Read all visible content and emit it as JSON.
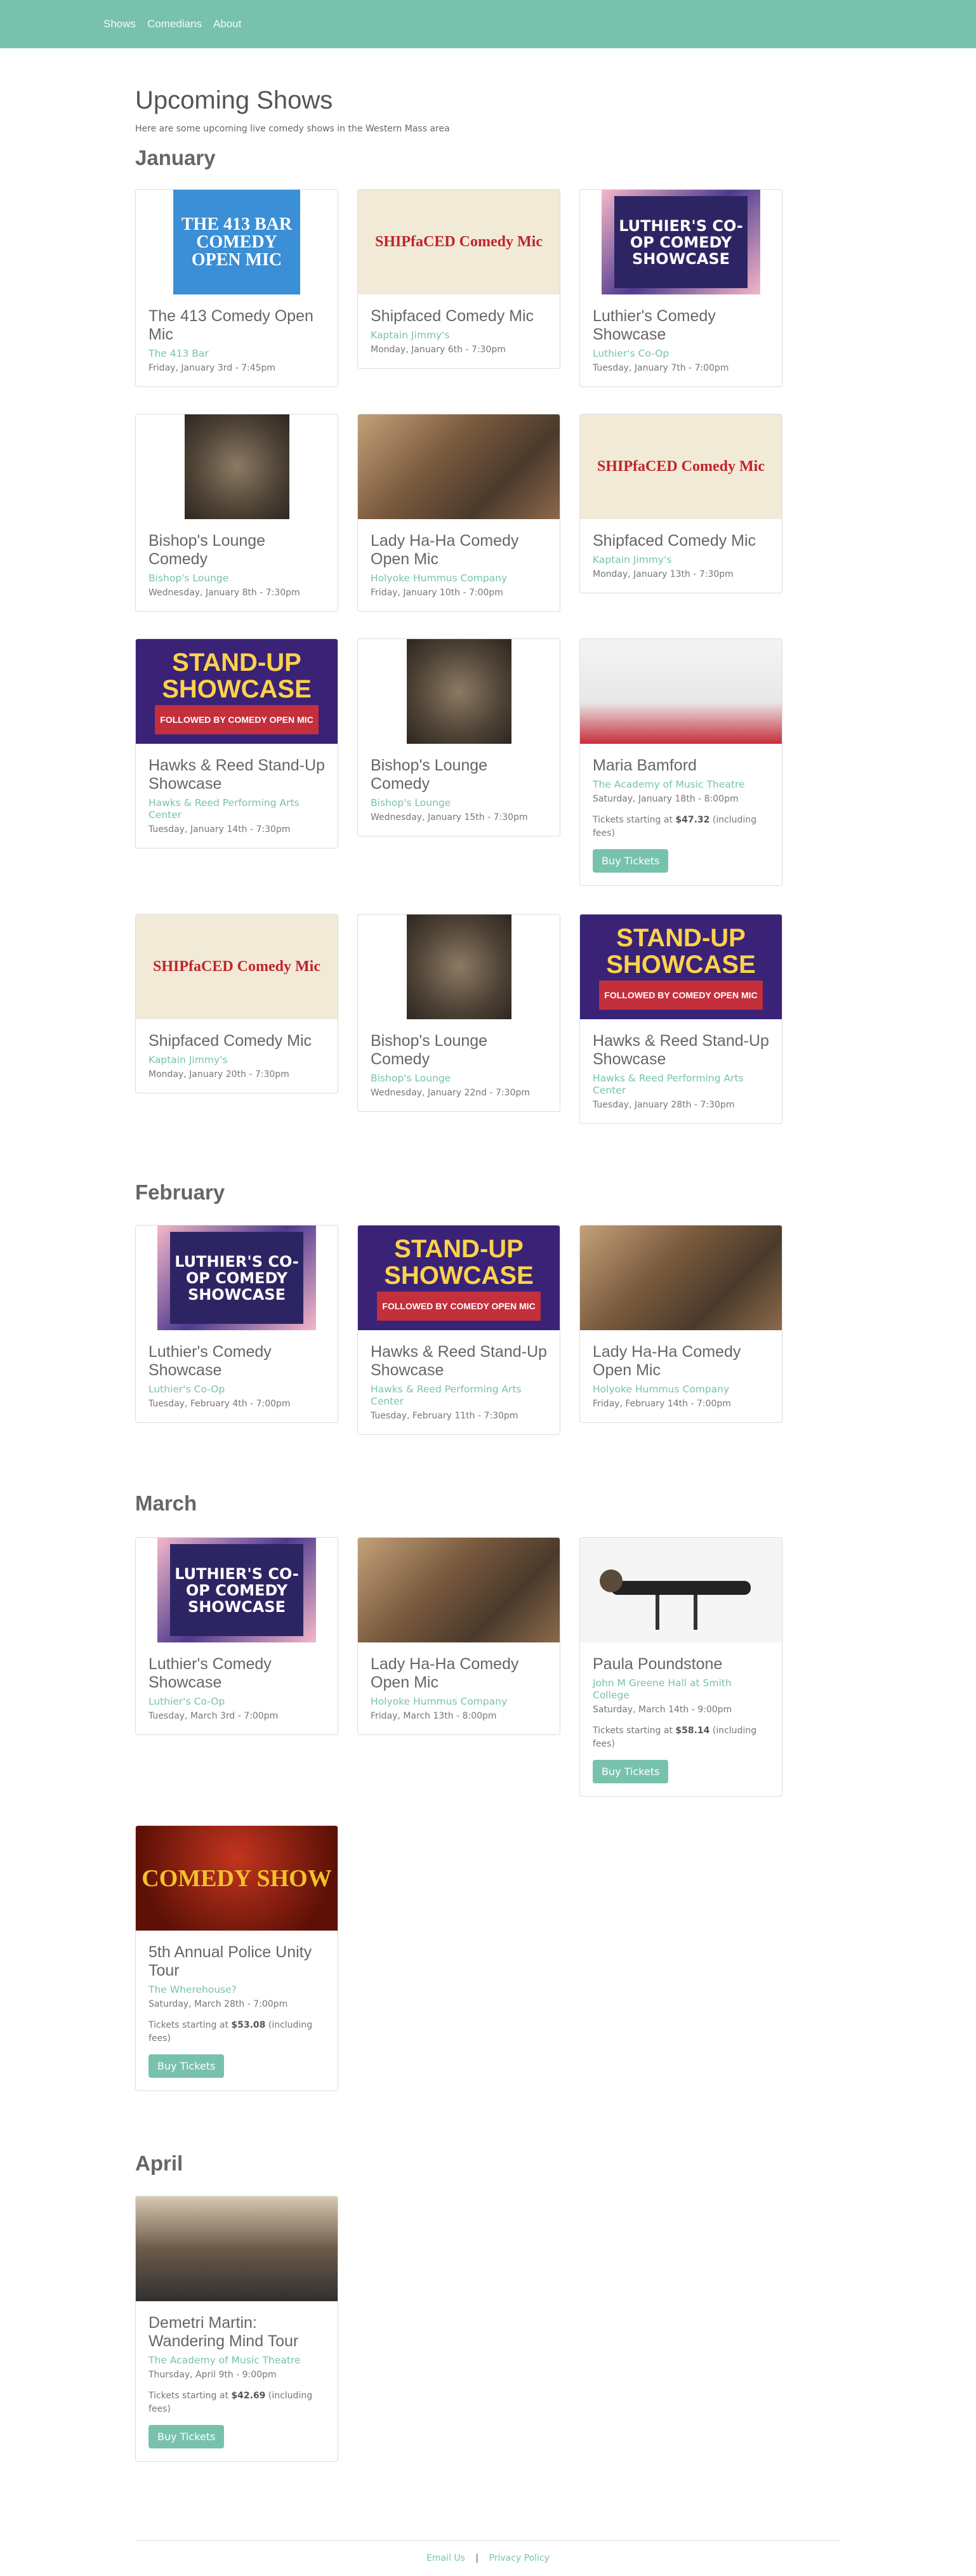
{
  "nav": {
    "items": [
      "Shows",
      "Comedians",
      "About"
    ]
  },
  "page": {
    "title": "Upcoming Shows",
    "subtitle": "Here are some upcoming live comedy shows in the Western Mass area"
  },
  "months": [
    "January",
    "February",
    "March",
    "April"
  ],
  "shows": [
    {
      "title": "The 413 Comedy Open Mic",
      "venue": "The 413 Bar",
      "date": "Friday, January 3rd - 7:45pm",
      "poster_text": "THE 413 BAR COMEDY OPEN MIC"
    },
    {
      "title": "Shipfaced Comedy Mic",
      "venue": "Kaptain Jimmy's",
      "date": "Monday, January 6th - 7:30pm",
      "poster_text": "SHIPfaCED Comedy Mic"
    },
    {
      "title": "Luthier's Comedy Showcase",
      "venue": "Luthier's Co-Op",
      "date": "Tuesday, January 7th - 7:00pm",
      "poster_text": "LUTHIER'S CO-OP COMEDY SHOWCASE"
    },
    {
      "title": "Bishop's Lounge Comedy",
      "venue": "Bishop's Lounge",
      "date": "Wednesday, January 8th - 7:30pm",
      "poster_text": ""
    },
    {
      "title": "Lady Ha-Ha Comedy Open Mic",
      "venue": "Holyoke Hummus Company",
      "date": "Friday, January 10th - 7:00pm"
    },
    {
      "title": "Shipfaced Comedy Mic",
      "venue": "Kaptain Jimmy's",
      "date": "Monday, January 13th - 7:30pm",
      "poster_text": "SHIPfaCED Comedy Mic"
    },
    {
      "title": "Hawks & Reed Stand-Up Showcase",
      "venue": "Hawks & Reed Performing Arts Center",
      "date": "Tuesday, January 14th - 7:30pm",
      "poster_text": "STAND-UP SHOWCASE",
      "poster_sub": "FOLLOWED BY COMEDY OPEN MIC"
    },
    {
      "title": "Bishop's Lounge Comedy",
      "venue": "Bishop's Lounge",
      "date": "Wednesday, January 15th - 7:30pm"
    },
    {
      "title": "Maria Bamford",
      "venue": "The Academy of Music Theatre",
      "date": "Saturday, January 18th - 8:00pm",
      "price_prefix": "Tickets starting at ",
      "price": "$47.32",
      "price_suffix": " (including fees)",
      "button": "Buy Tickets"
    },
    {
      "title": "Shipfaced Comedy Mic",
      "venue": "Kaptain Jimmy's",
      "date": "Monday, January 20th - 7:30pm",
      "poster_text": "SHIPfaCED Comedy Mic"
    },
    {
      "title": "Bishop's Lounge Comedy",
      "venue": "Bishop's Lounge",
      "date": "Wednesday, January 22nd - 7:30pm"
    },
    {
      "title": "Hawks & Reed Stand-Up Showcase",
      "venue": "Hawks & Reed Performing Arts Center",
      "date": "Tuesday, January 28th - 7:30pm",
      "poster_text": "STAND-UP SHOWCASE",
      "poster_sub": "FOLLOWED BY COMEDY OPEN MIC"
    },
    {
      "title": "Luthier's Comedy Showcase",
      "venue": "Luthier's Co-Op",
      "date": "Tuesday, February 4th - 7:00pm",
      "poster_text": "LUTHIER'S CO-OP COMEDY SHOWCASE"
    },
    {
      "title": "Hawks & Reed Stand-Up Showcase",
      "venue": "Hawks & Reed Performing Arts Center",
      "date": "Tuesday, February 11th - 7:30pm",
      "poster_text": "STAND-UP SHOWCASE",
      "poster_sub": "FOLLOWED BY COMEDY OPEN MIC"
    },
    {
      "title": "Lady Ha-Ha Comedy Open Mic",
      "venue": "Holyoke Hummus Company",
      "date": "Friday, February 14th - 7:00pm"
    },
    {
      "title": "Luthier's Comedy Showcase",
      "venue": "Luthier's Co-Op",
      "date": "Tuesday, March 3rd - 7:00pm",
      "poster_text": "LUTHIER'S CO-OP COMEDY SHOWCASE"
    },
    {
      "title": "Lady Ha-Ha Comedy Open Mic",
      "venue": "Holyoke Hummus Company",
      "date": "Friday, March 13th - 8:00pm"
    },
    {
      "title": "Paula Poundstone",
      "venue": "John M Greene Hall at Smith College",
      "date": "Saturday, March 14th - 9:00pm",
      "price_prefix": "Tickets starting at ",
      "price": "$58.14",
      "price_suffix": " (including fees)",
      "button": "Buy Tickets"
    },
    {
      "title": "5th Annual Police Unity Tour",
      "venue": "The Wherehouse?",
      "date": "Saturday, March 28th - 7:00pm",
      "price_prefix": "Tickets starting at ",
      "price": "$53.08",
      "price_suffix": " (including fees)",
      "button": "Buy Tickets",
      "poster_text": "COMEDY SHOW"
    },
    {
      "title": "Demetri Martin: Wandering Mind Tour",
      "venue": "The Academy of Music Theatre",
      "date": "Thursday, April 9th - 9:00pm",
      "price_prefix": "Tickets starting at ",
      "price": "$42.69",
      "price_suffix": " (including fees)",
      "button": "Buy Tickets"
    }
  ],
  "footer": {
    "email": "Email Us",
    "separator": "|",
    "privacy": "Privacy Policy"
  },
  "colors": {
    "accent": "#78c2ad",
    "navbar": "#78c2ad"
  }
}
